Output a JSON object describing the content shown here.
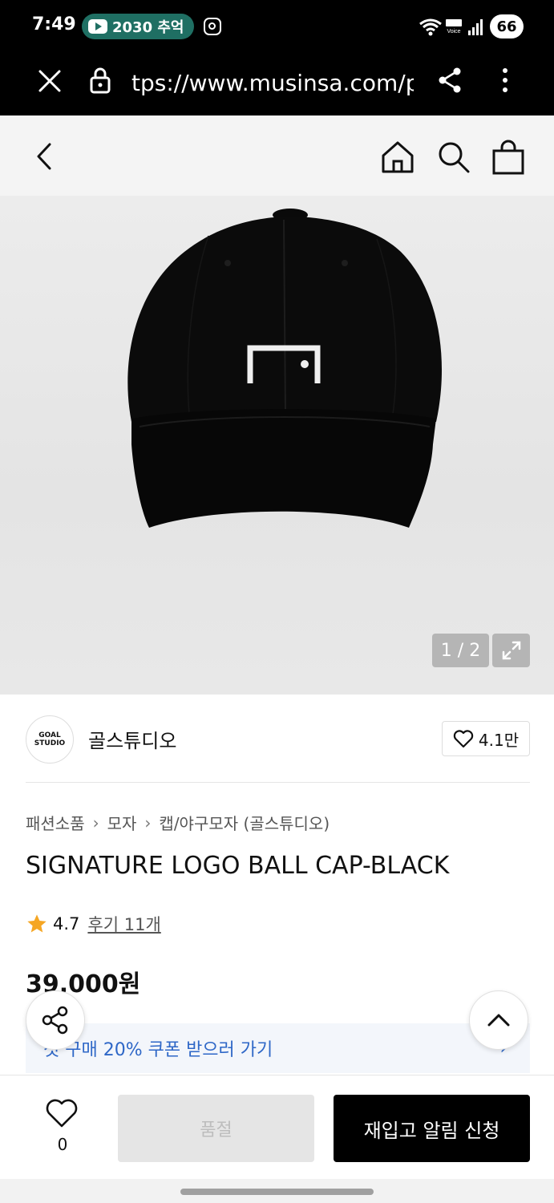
{
  "status_bar": {
    "time": "7:49",
    "notification_text": "2030 추억",
    "battery": "66"
  },
  "browser": {
    "url": "tps://www.musinsa.com/p"
  },
  "gallery": {
    "counter": "1 / 2"
  },
  "brand": {
    "logo_text_1": "GOAL",
    "logo_text_2": "STUDIO",
    "name": "골스튜디오",
    "likes": "4.1만"
  },
  "breadcrumb": [
    "패션소품",
    "모자",
    "캡/야구모자 (골스튜디오)"
  ],
  "product": {
    "title": "SIGNATURE LOGO BALL CAP-BLACK",
    "rating": "4.7",
    "review_link": "후기 11개",
    "price": "39,000원"
  },
  "coupon": {
    "text": "첫 구매 20% 쿠폰 받으러 가기"
  },
  "bottom_bar": {
    "wish_count": "0",
    "soldout_label": "품절",
    "restock_label": "재입고 알림 신청"
  },
  "colors": {
    "accent_blue": "#2e67c7",
    "star": "#f5a623",
    "cta": "#000000"
  }
}
